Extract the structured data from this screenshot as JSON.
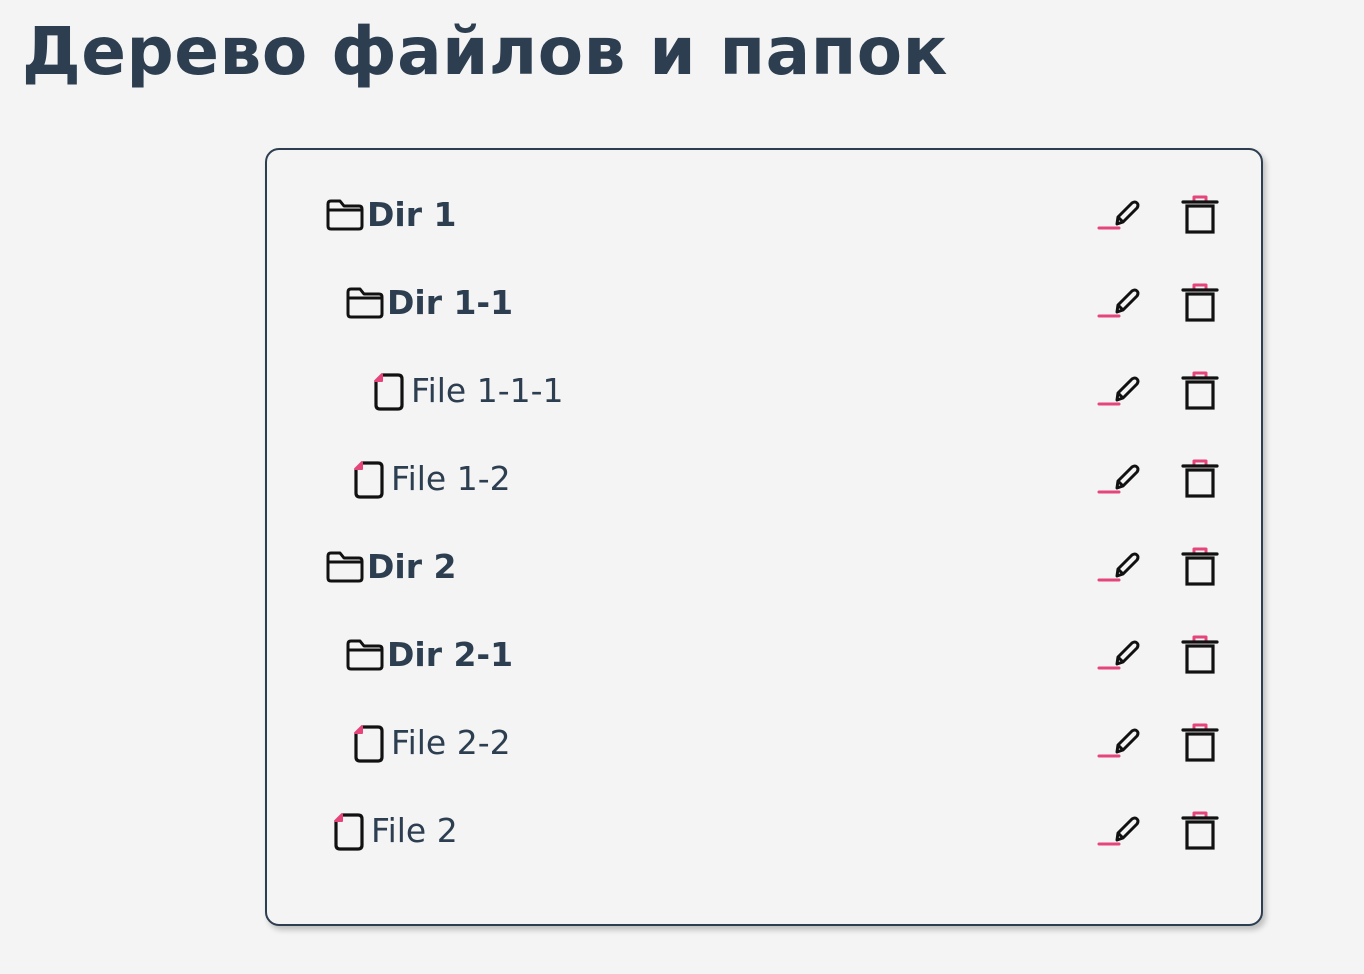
{
  "page": {
    "title": "Дерево файлов и папок"
  },
  "colors": {
    "text": "#2c3e50",
    "accent": "#e6457a",
    "icon": "#111111",
    "background": "#f4f4f4"
  },
  "icons": {
    "directory": "folder-icon",
    "file": "file-icon",
    "edit": "pencil-icon",
    "delete": "trash-icon"
  },
  "tree": {
    "items": [
      {
        "label": "Dir 1",
        "type": "dir",
        "depth": 0
      },
      {
        "label": "Dir 1-1",
        "type": "dir",
        "depth": 1
      },
      {
        "label": "File 1-1-1",
        "type": "file",
        "depth": 2
      },
      {
        "label": "File 1-2",
        "type": "file",
        "depth": 1
      },
      {
        "label": "Dir 2",
        "type": "dir",
        "depth": 0
      },
      {
        "label": "Dir 2-1",
        "type": "dir",
        "depth": 1
      },
      {
        "label": "File 2-2",
        "type": "file",
        "depth": 1
      },
      {
        "label": "File 2",
        "type": "file",
        "depth": 0
      }
    ]
  }
}
